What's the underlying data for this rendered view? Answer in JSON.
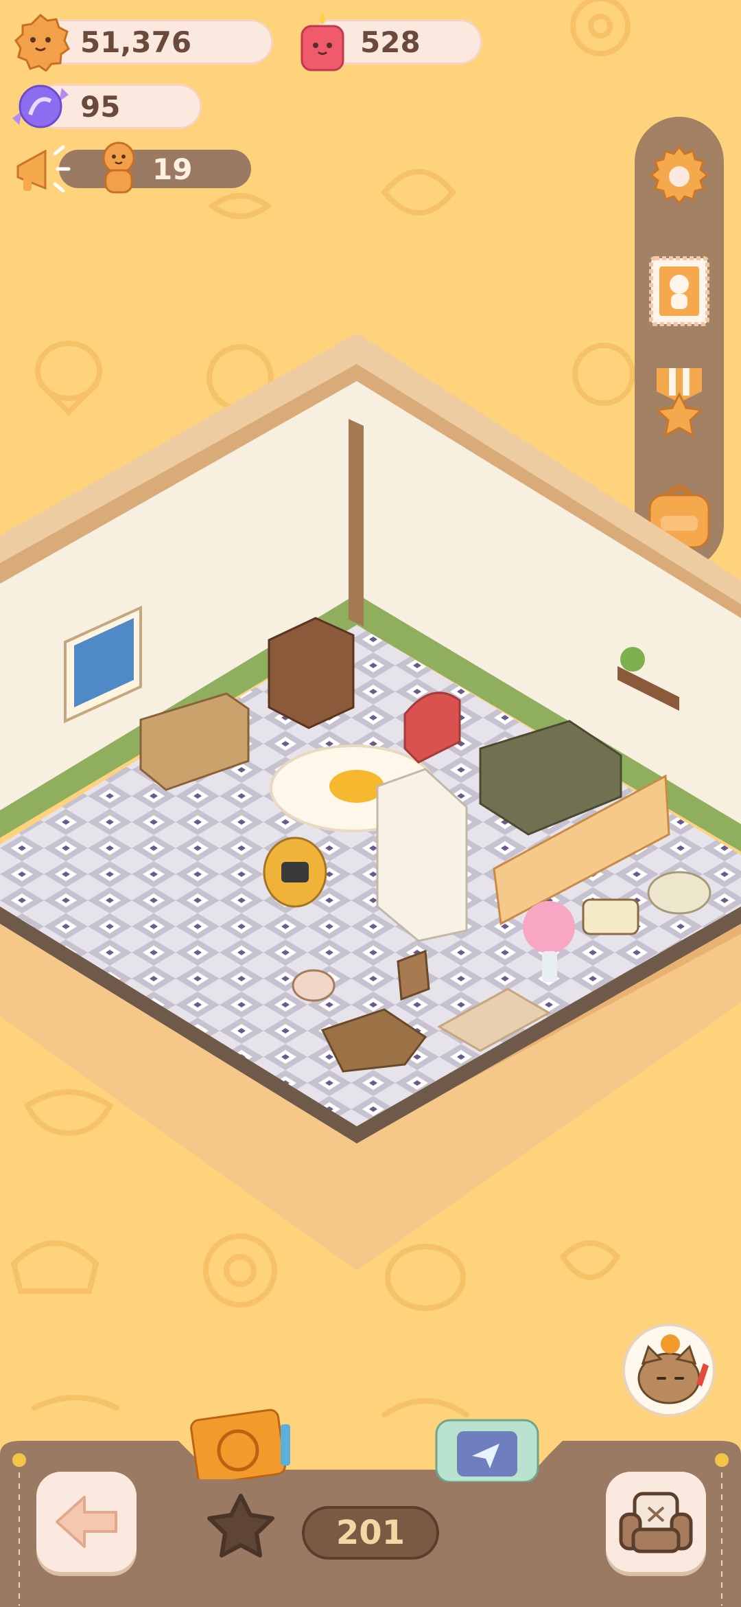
{
  "resources": {
    "cookies": {
      "value": "51,376",
      "icon": "cookie-icon"
    },
    "candles": {
      "value": "528",
      "icon": "candle-icon"
    },
    "candy": {
      "value": "95",
      "icon": "candy-icon"
    },
    "visitors": {
      "value": "19",
      "icon": "gingerbread-icon",
      "announce_icon": "megaphone-icon"
    }
  },
  "side_menu": [
    {
      "name": "settings",
      "icon": "gear-icon"
    },
    {
      "name": "stamp",
      "icon": "stamp-icon"
    },
    {
      "name": "achievements",
      "icon": "medal-icon"
    },
    {
      "name": "bag",
      "icon": "backpack-icon"
    }
  ],
  "bottom_bar": {
    "count": "201",
    "back_icon": "arrow-left-icon",
    "furniture_icon": "armchair-icon",
    "album_icon": "folder-icon",
    "camera_icon": "camera-icon",
    "star_icon": "star-icon"
  },
  "colors": {
    "background": "#ffd27c",
    "panel": "#9b7a63",
    "pill": "#fbe9df",
    "text": "#6b4a3b"
  }
}
